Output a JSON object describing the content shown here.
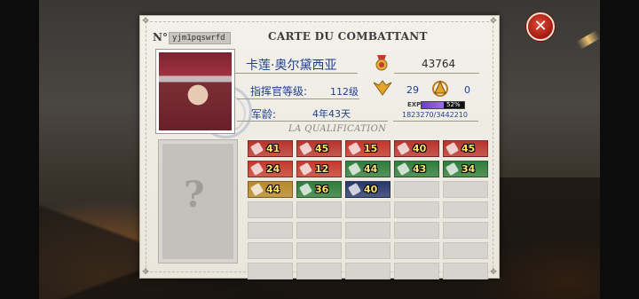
{
  "card": {
    "title": "CARTE DU COMBATTANT",
    "serial_prefix": "N°",
    "serial": "yjm1pqswrfd"
  },
  "profile": {
    "name": "卡莲·奥尔黛西亚",
    "power": "43764",
    "level_label": "指挥官等级:",
    "level_value": "112级",
    "wing_value": "29",
    "tri_value": "0",
    "exp_label": "EXP",
    "exp_percent_text": "52%",
    "exp_fraction": 0.52,
    "exp_numbers": "1823270/3442210",
    "age_label": "军龄:",
    "age_value": "4年43天"
  },
  "qualification": {
    "title": "LA QUALIFICATION",
    "badges": [
      {
        "value": "41",
        "color": "#b9332b",
        "icon": "bullet-icon"
      },
      {
        "value": "45",
        "color": "#b9332b",
        "icon": "shell-icon"
      },
      {
        "value": "15",
        "color": "#c2342a",
        "icon": "rocket-icon"
      },
      {
        "value": "40",
        "color": "#b9332b",
        "icon": "grenade-icon"
      },
      {
        "value": "45",
        "color": "#b9332b",
        "icon": "rifle-icon"
      },
      {
        "value": "24",
        "color": "#c53a2c",
        "icon": "missile-icon"
      },
      {
        "value": "12",
        "color": "#c53a2c",
        "icon": "torpedo-icon"
      },
      {
        "value": "44",
        "color": "#2f7d3a",
        "icon": "armor-icon"
      },
      {
        "value": "43",
        "color": "#2f7d3a",
        "icon": "plane-icon"
      },
      {
        "value": "34",
        "color": "#2f7d3a",
        "icon": "tank-icon"
      },
      {
        "value": "44",
        "color": "#b8892a",
        "icon": "ship-icon"
      },
      {
        "value": "36",
        "color": "#2f7d3a",
        "icon": "camp-icon"
      },
      {
        "value": "40",
        "color": "#27376d",
        "icon": "trophy-icon"
      }
    ]
  },
  "colors": {
    "accent_blue": "#1f3f91",
    "close_red": "#c42a1c"
  }
}
